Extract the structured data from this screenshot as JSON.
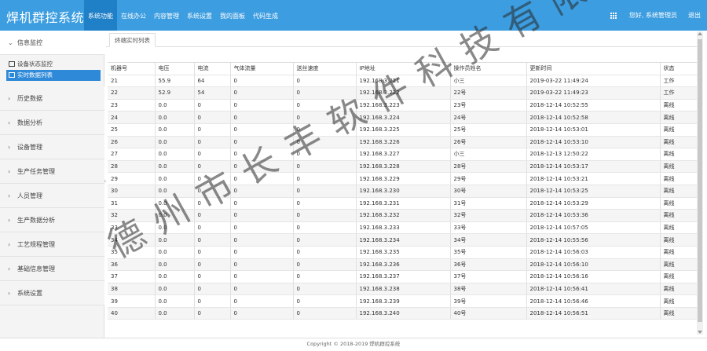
{
  "header": {
    "brand": "焊机群控系统",
    "nav": [
      "系统功能",
      "在线办公",
      "内容管理",
      "系统设置",
      "我的面板",
      "代码生成"
    ],
    "active_nav": 0,
    "user": "您好, 系统管理员",
    "logout": "退出"
  },
  "sidebar": {
    "groups": [
      {
        "label": "信息监控",
        "open": true,
        "children": [
          "设备状态监控",
          "实时数据列表"
        ]
      },
      {
        "label": "历史数据"
      },
      {
        "label": "数据分析"
      },
      {
        "label": "设备管理"
      },
      {
        "label": "生产任务管理"
      },
      {
        "label": "人员管理"
      },
      {
        "label": "生产数据分析"
      },
      {
        "label": "工艺规程管理"
      },
      {
        "label": "基础信息管理"
      },
      {
        "label": "系统设置"
      }
    ],
    "active_child": "实时数据列表"
  },
  "tab": {
    "label": "终端实时列表"
  },
  "table": {
    "columns": [
      "机器号",
      "电压",
      "电流",
      "气体流量",
      "送丝速度",
      "IP地址",
      "操作员姓名",
      "更新时间",
      "状态"
    ],
    "rows": [
      [
        "21",
        "55.9",
        "64",
        "0",
        "0",
        "192.168.3.221",
        "小三",
        "2019-03-22 11:49:24",
        "工作"
      ],
      [
        "22",
        "52.9",
        "54",
        "0",
        "0",
        "192.168.3.222",
        "22号",
        "2019-03-22 11:49:23",
        "工作"
      ],
      [
        "23",
        "0.0",
        "0",
        "0",
        "0",
        "192.168.3.223",
        "23号",
        "2018-12-14 10:52:55",
        "离线"
      ],
      [
        "24",
        "0.0",
        "0",
        "0",
        "0",
        "192.168.3.224",
        "24号",
        "2018-12-14 10:52:58",
        "离线"
      ],
      [
        "25",
        "0.0",
        "0",
        "0",
        "0",
        "192.168.3.225",
        "25号",
        "2018-12-14 10:53:01",
        "离线"
      ],
      [
        "26",
        "0.0",
        "0",
        "0",
        "0",
        "192.168.3.226",
        "26号",
        "2018-12-14 10:53:10",
        "离线"
      ],
      [
        "27",
        "0.0",
        "0",
        "0",
        "0",
        "192.168.3.227",
        "小三",
        "2018-12-13 12:50:22",
        "离线"
      ],
      [
        "28",
        "0.0",
        "0",
        "0",
        "0",
        "192.168.3.228",
        "28号",
        "2018-12-14 10:53:17",
        "离线"
      ],
      [
        "29",
        "0.0",
        "0",
        "0",
        "0",
        "192.168.3.229",
        "29号",
        "2018-12-14 10:53:21",
        "离线"
      ],
      [
        "30",
        "0.0",
        "0",
        "0",
        "0",
        "192.168.3.230",
        "30号",
        "2018-12-14 10:53:25",
        "离线"
      ],
      [
        "31",
        "0.0",
        "0",
        "0",
        "0",
        "192.168.3.231",
        "31号",
        "2018-12-14 10:53:29",
        "离线"
      ],
      [
        "32",
        "0.0",
        "0",
        "0",
        "0",
        "192.168.3.232",
        "32号",
        "2018-12-14 10:53:36",
        "离线"
      ],
      [
        "33",
        "0.0",
        "0",
        "0",
        "0",
        "192.168.3.233",
        "33号",
        "2018-12-14 10:57:05",
        "离线"
      ],
      [
        "34",
        "0.0",
        "0",
        "0",
        "0",
        "192.168.3.234",
        "34号",
        "2018-12-14 10:55:56",
        "离线"
      ],
      [
        "35",
        "0.0",
        "0",
        "0",
        "0",
        "192.168.3.235",
        "35号",
        "2018-12-14 10:56:03",
        "离线"
      ],
      [
        "36",
        "0.0",
        "0",
        "0",
        "0",
        "192.168.3.236",
        "36号",
        "2018-12-14 10:56:10",
        "离线"
      ],
      [
        "37",
        "0.0",
        "0",
        "0",
        "0",
        "192.168.3.237",
        "37号",
        "2018-12-14 10:56:16",
        "离线"
      ],
      [
        "38",
        "0.0",
        "0",
        "0",
        "0",
        "192.168.3.238",
        "38号",
        "2018-12-14 10:56:41",
        "离线"
      ],
      [
        "39",
        "0.0",
        "0",
        "0",
        "0",
        "192.168.3.239",
        "39号",
        "2018-12-14 10:56:46",
        "离线"
      ],
      [
        "40",
        "0.0",
        "0",
        "0",
        "0",
        "192.168.3.240",
        "40号",
        "2018-12-14 10:56:51",
        "离线"
      ]
    ]
  },
  "footer": "Copyright © 2018-2019 焊机群控系统",
  "watermark": "德州市长丰软件科技有限公司",
  "colors": {
    "header_bg": "#3c9de0",
    "nav_active": "#1f7fc7",
    "sidebar_active": "#2e8ad8"
  }
}
